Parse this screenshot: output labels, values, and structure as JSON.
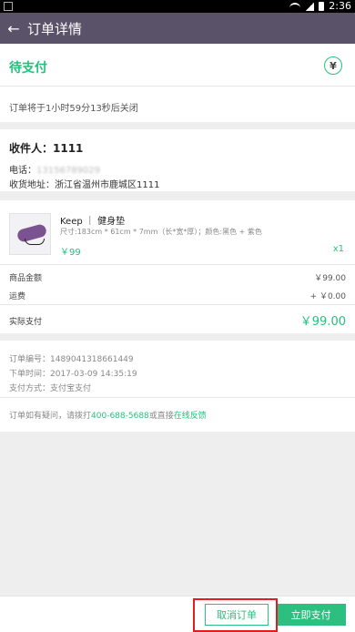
{
  "status_bar": {
    "time": "2:36"
  },
  "app_bar": {
    "title": "订单详情",
    "back_icon": "arrow-left-icon"
  },
  "order_status": {
    "title": "待支付",
    "badge_glyph": "¥",
    "close_note": "订单将于1小时59分13秒后关闭"
  },
  "receiver": {
    "name_line": "收件人：1111",
    "phone_label": "电话：",
    "phone_value": "13156789029",
    "address_line": "收货地址：浙江省温州市鹿城区1111"
  },
  "product": {
    "name": "Keep ｜ 健身垫",
    "spec": "尺寸:183cm * 61cm * 7mm（长*宽*厚）；颜色:黑色 + 紫色",
    "price": "￥99",
    "qty": "x1"
  },
  "amounts": {
    "goods_label": "商品金额",
    "goods_value": "￥99.00",
    "shipping_label": "运费",
    "shipping_value": "+ ￥0.00",
    "paid_label": "实际支付",
    "paid_value": "￥99.00"
  },
  "order_info": {
    "number": "订单编号：1489041318661449",
    "time": "下单时间：2017-03-09 14:35:19",
    "payment": "支付方式：支付宝支付"
  },
  "help": {
    "prefix": "订单如有疑问，请拨打",
    "phone": "400-688-5688",
    "middle": "或直接",
    "link": "在线反馈"
  },
  "actions": {
    "cancel": "取消订单",
    "pay": "立即支付"
  },
  "colors": {
    "accent": "#2bbf80",
    "appbar": "#595268",
    "highlight": "#e31d1d"
  }
}
